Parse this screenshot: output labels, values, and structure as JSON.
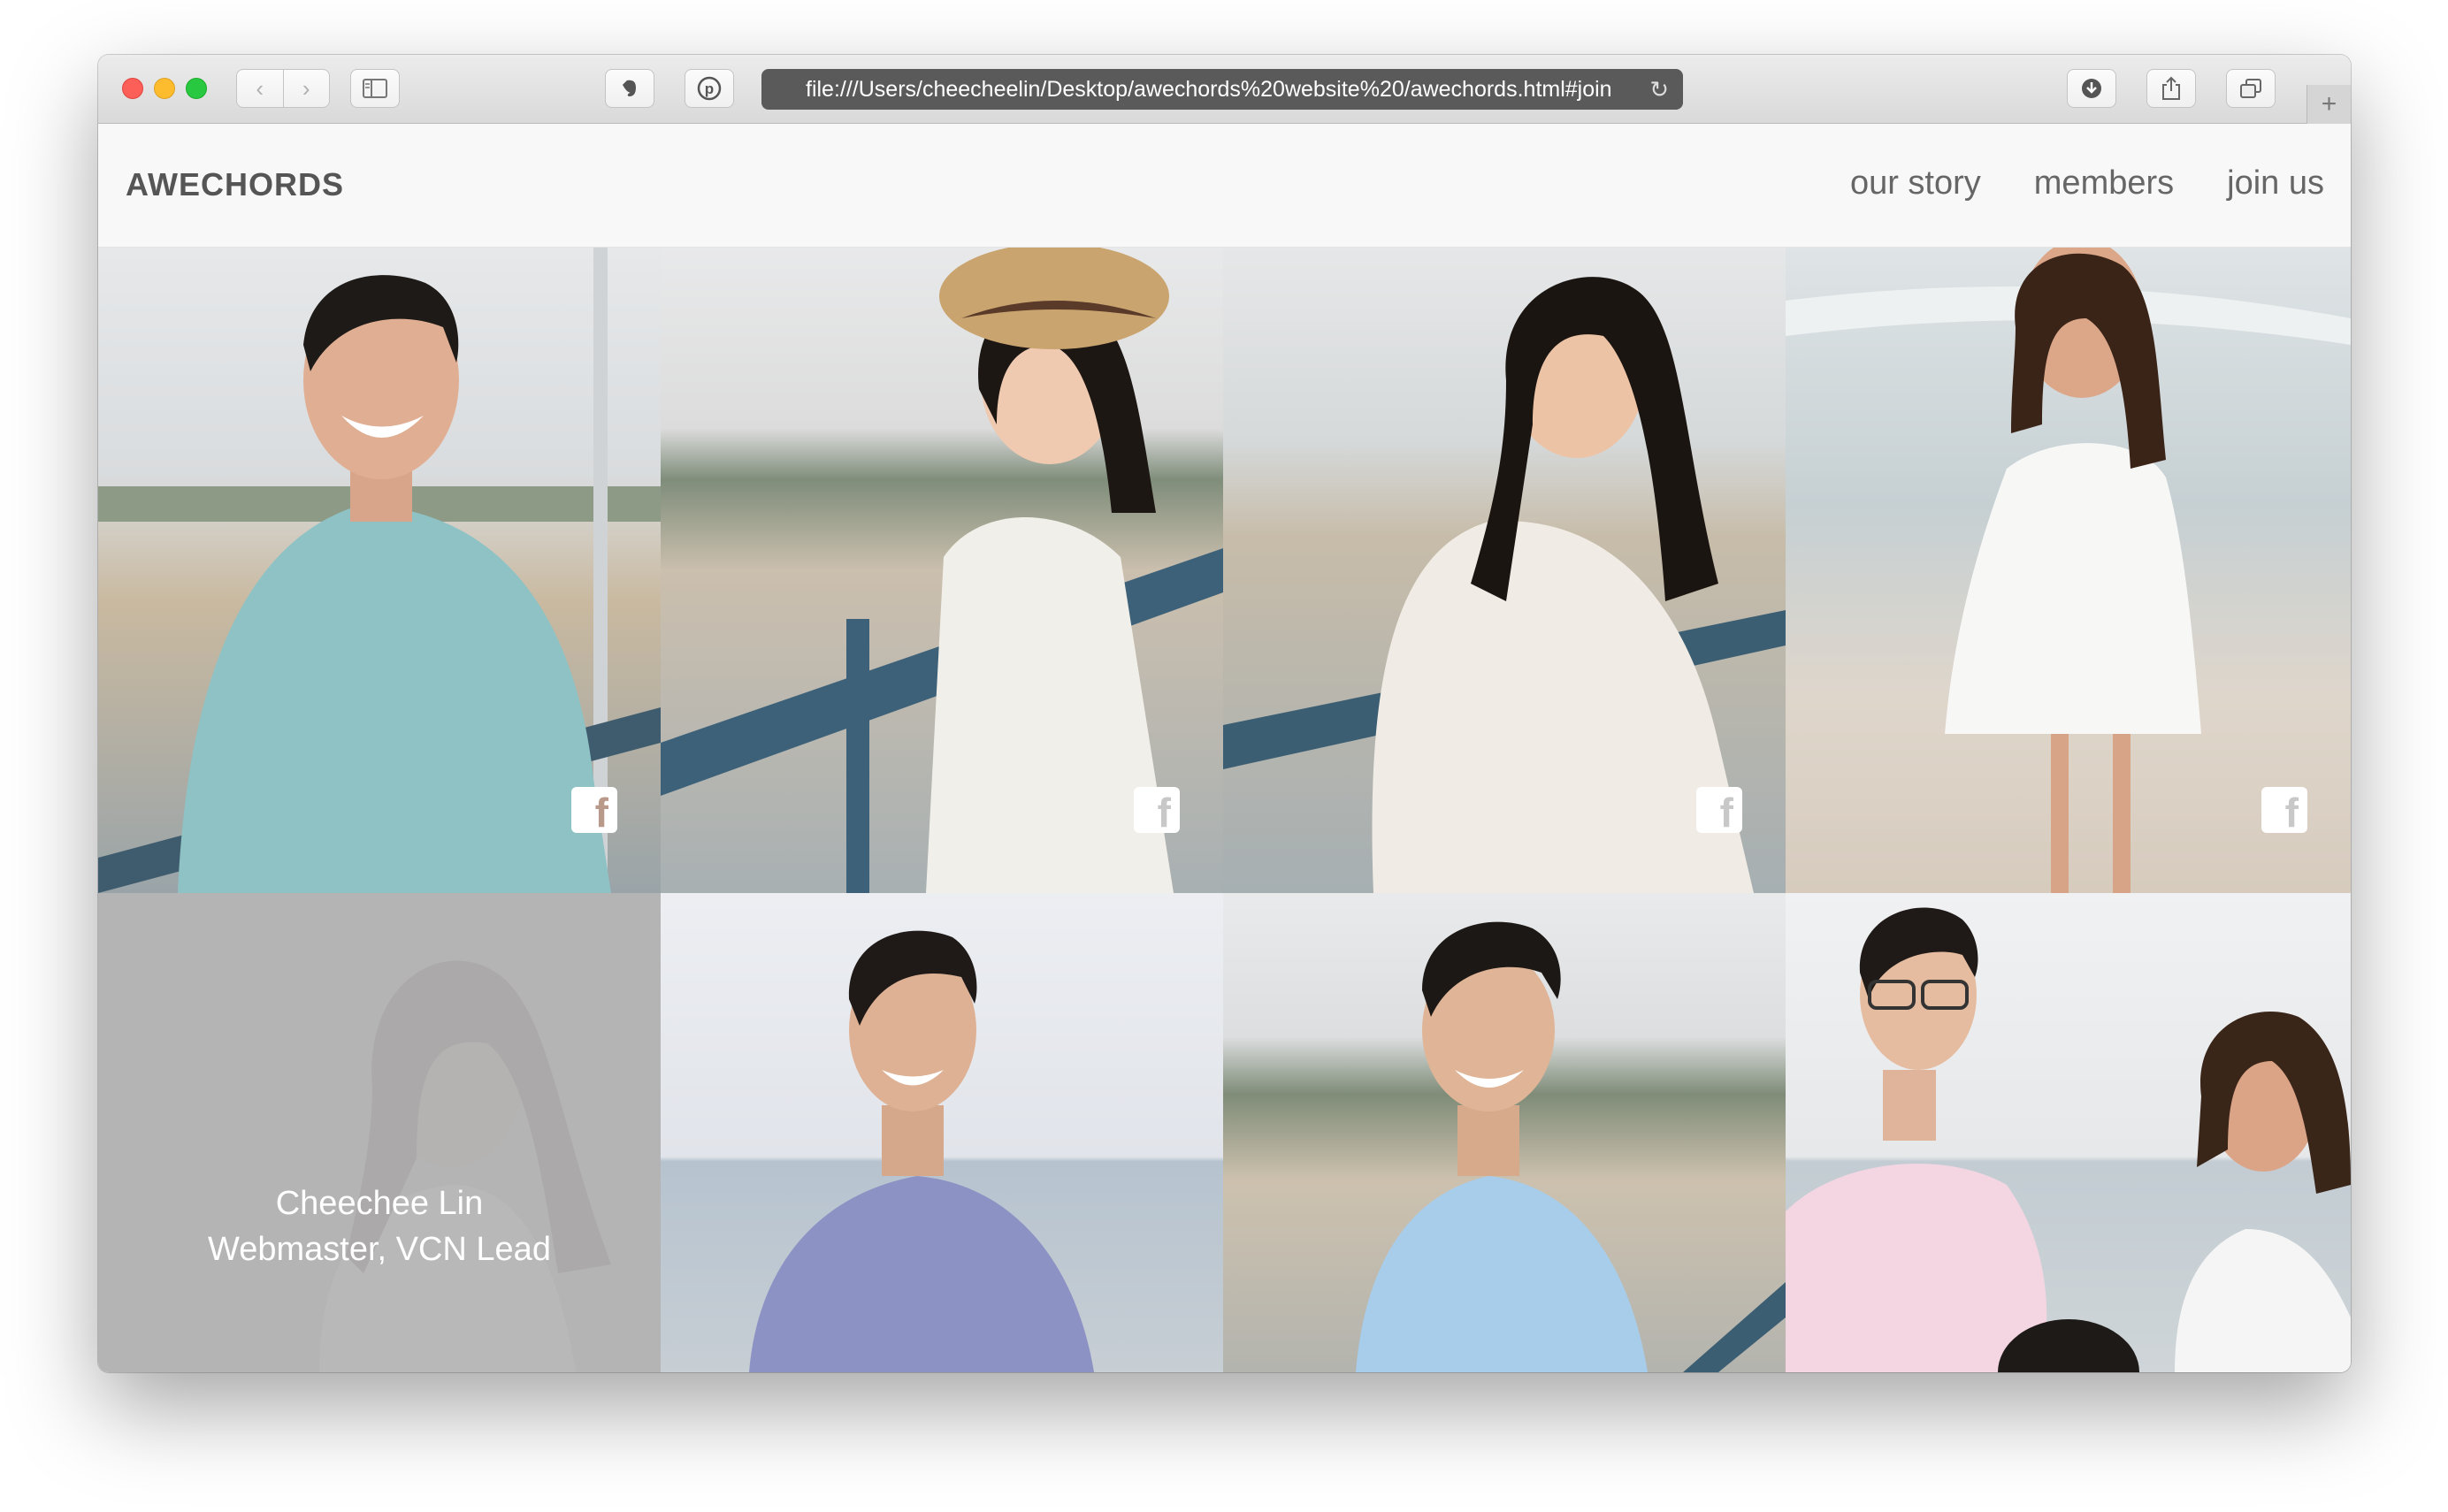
{
  "browser": {
    "url": "file:///Users/cheecheelin/Desktop/awechords%20website%20/awechords.html#join",
    "back_icon": "chevron-left-icon",
    "forward_icon": "chevron-right-icon"
  },
  "site": {
    "logo": "AWECHORDS",
    "nav": [
      "our story",
      "members",
      "join us"
    ]
  },
  "members": [
    {
      "photo": "member-photo-1",
      "facebook": "f"
    },
    {
      "photo": "member-photo-2",
      "facebook": "f"
    },
    {
      "photo": "member-photo-3",
      "facebook": "f"
    },
    {
      "photo": "member-photo-4",
      "facebook": "f"
    },
    {
      "photo": "member-photo-5",
      "name": "Cheechee Lin",
      "role": "Webmaster, VCN Lead"
    },
    {
      "photo": "member-photo-6"
    },
    {
      "photo": "member-photo-7"
    },
    {
      "photo": "member-photo-8"
    }
  ]
}
